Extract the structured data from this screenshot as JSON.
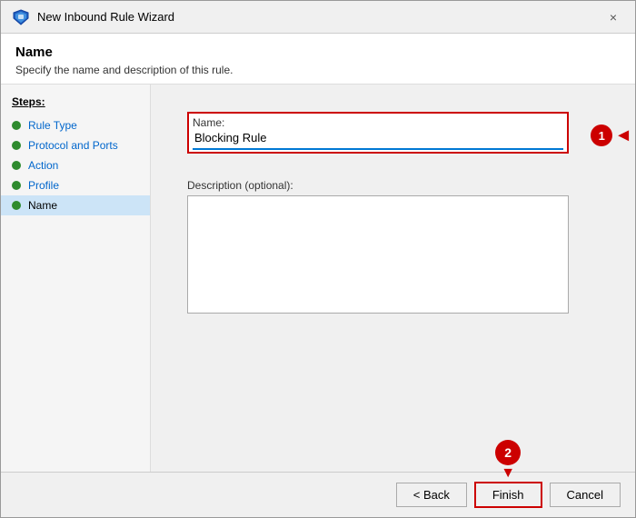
{
  "window": {
    "title": "New Inbound Rule Wizard",
    "close_label": "×"
  },
  "header": {
    "title": "Name",
    "subtitle": "Specify the name and description of this rule."
  },
  "steps": {
    "title": "Steps:",
    "items": [
      {
        "label": "Rule Type",
        "active": false
      },
      {
        "label": "Protocol and Ports",
        "active": false
      },
      {
        "label": "Action",
        "active": false
      },
      {
        "label": "Profile",
        "active": false
      },
      {
        "label": "Name",
        "active": true
      }
    ]
  },
  "form": {
    "name_label": "Name:",
    "name_value": "Blocking Rule",
    "description_label": "Description (optional):",
    "description_value": ""
  },
  "footer": {
    "back_label": "< Back",
    "finish_label": "Finish",
    "cancel_label": "Cancel"
  },
  "annotations": {
    "badge_1": "1",
    "badge_2": "2"
  }
}
